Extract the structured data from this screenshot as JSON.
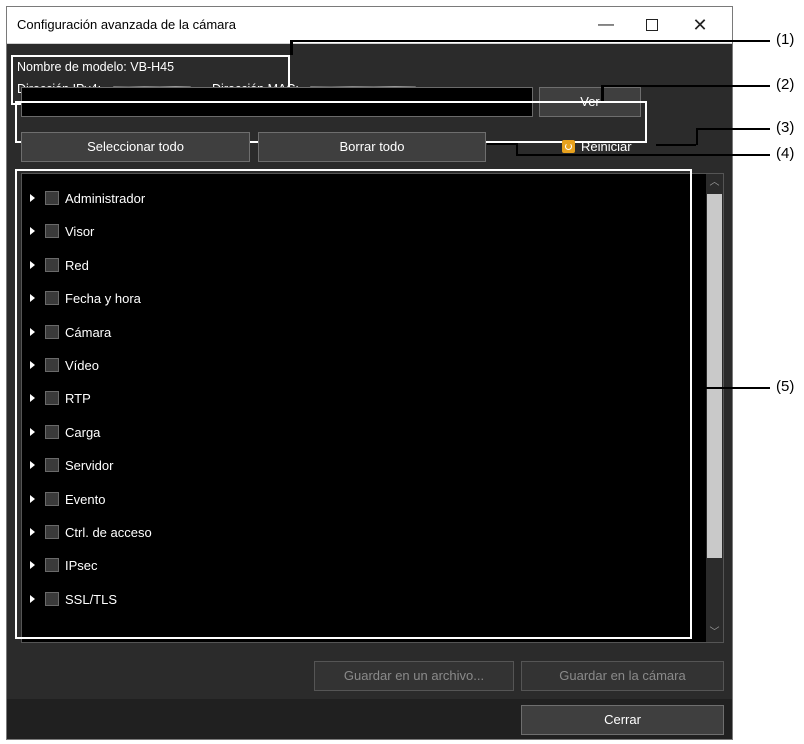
{
  "window": {
    "title": "Configuración avanzada de la cámara",
    "min_symbol": "—",
    "close_symbol": "✕"
  },
  "info": {
    "model_label": "Nombre de modelo:",
    "model_value": "VB-H45",
    "ipv4_label": "Dirección IPv4:",
    "mac_label": "Dirección MAC:"
  },
  "toolbar": {
    "url_value": "",
    "view_button": "Ver",
    "select_all_button": "Seleccionar todo",
    "clear_all_button": "Borrar todo",
    "restart_label": "Reiniciar"
  },
  "tree": {
    "items": [
      {
        "label": "Administrador",
        "checked": false
      },
      {
        "label": "Visor",
        "checked": false
      },
      {
        "label": "Red",
        "checked": false
      },
      {
        "label": "Fecha y hora",
        "checked": false
      },
      {
        "label": "Cámara",
        "checked": false
      },
      {
        "label": "Vídeo",
        "checked": false
      },
      {
        "label": "RTP",
        "checked": false
      },
      {
        "label": "Carga",
        "checked": false
      },
      {
        "label": "Servidor",
        "checked": false
      },
      {
        "label": "Evento",
        "checked": false
      },
      {
        "label": "Ctrl. de acceso",
        "checked": false
      },
      {
        "label": "IPsec",
        "checked": false
      },
      {
        "label": "SSL/TLS",
        "checked": false
      }
    ]
  },
  "footer": {
    "save_file_button": "Guardar en un archivo...",
    "save_camera_button": "Guardar en la cámara",
    "close_button": "Cerrar"
  },
  "callouts": {
    "c1": "(1)",
    "c2": "(2)",
    "c3": "(3)",
    "c4": "(4)",
    "c5": "(5)"
  },
  "colors": {
    "window_bg": "#2b2b2b",
    "panel_bg": "#000000",
    "restart_icon": "#e8a21e"
  }
}
